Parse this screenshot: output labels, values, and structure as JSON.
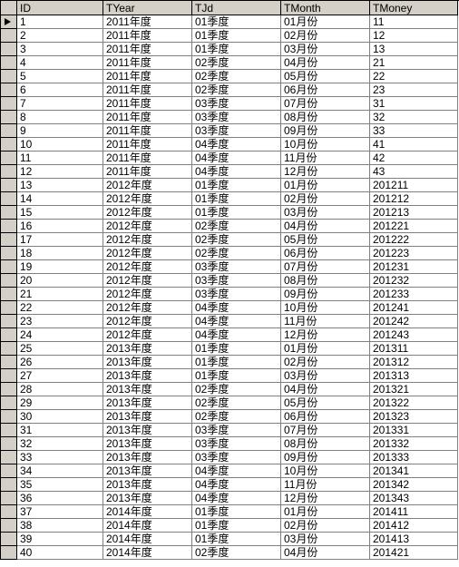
{
  "columns": {
    "id": "ID",
    "tyear": "TYear",
    "tjd": "TJd",
    "tmonth": "TMonth",
    "tmoney": "TMoney"
  },
  "rows": [
    {
      "id": "1",
      "tyear": "2011年度",
      "tjd": "01季度",
      "tmonth": "01月份",
      "tmoney": "11"
    },
    {
      "id": "2",
      "tyear": "2011年度",
      "tjd": "01季度",
      "tmonth": "02月份",
      "tmoney": "12"
    },
    {
      "id": "3",
      "tyear": "2011年度",
      "tjd": "01季度",
      "tmonth": "03月份",
      "tmoney": "13"
    },
    {
      "id": "4",
      "tyear": "2011年度",
      "tjd": "02季度",
      "tmonth": "04月份",
      "tmoney": "21"
    },
    {
      "id": "5",
      "tyear": "2011年度",
      "tjd": "02季度",
      "tmonth": "05月份",
      "tmoney": "22"
    },
    {
      "id": "6",
      "tyear": "2011年度",
      "tjd": "02季度",
      "tmonth": "06月份",
      "tmoney": "23"
    },
    {
      "id": "7",
      "tyear": "2011年度",
      "tjd": "03季度",
      "tmonth": "07月份",
      "tmoney": "31"
    },
    {
      "id": "8",
      "tyear": "2011年度",
      "tjd": "03季度",
      "tmonth": "08月份",
      "tmoney": "32"
    },
    {
      "id": "9",
      "tyear": "2011年度",
      "tjd": "03季度",
      "tmonth": "09月份",
      "tmoney": "33"
    },
    {
      "id": "10",
      "tyear": "2011年度",
      "tjd": "04季度",
      "tmonth": "10月份",
      "tmoney": "41"
    },
    {
      "id": "11",
      "tyear": "2011年度",
      "tjd": "04季度",
      "tmonth": "11月份",
      "tmoney": "42"
    },
    {
      "id": "12",
      "tyear": "2011年度",
      "tjd": "04季度",
      "tmonth": "12月份",
      "tmoney": "43"
    },
    {
      "id": "13",
      "tyear": "2012年度",
      "tjd": "01季度",
      "tmonth": "01月份",
      "tmoney": "201211"
    },
    {
      "id": "14",
      "tyear": "2012年度",
      "tjd": "01季度",
      "tmonth": "02月份",
      "tmoney": "201212"
    },
    {
      "id": "15",
      "tyear": "2012年度",
      "tjd": "01季度",
      "tmonth": "03月份",
      "tmoney": "201213"
    },
    {
      "id": "16",
      "tyear": "2012年度",
      "tjd": "02季度",
      "tmonth": "04月份",
      "tmoney": "201221"
    },
    {
      "id": "17",
      "tyear": "2012年度",
      "tjd": "02季度",
      "tmonth": "05月份",
      "tmoney": "201222"
    },
    {
      "id": "18",
      "tyear": "2012年度",
      "tjd": "02季度",
      "tmonth": "06月份",
      "tmoney": "201223"
    },
    {
      "id": "19",
      "tyear": "2012年度",
      "tjd": "03季度",
      "tmonth": "07月份",
      "tmoney": "201231"
    },
    {
      "id": "20",
      "tyear": "2012年度",
      "tjd": "03季度",
      "tmonth": "08月份",
      "tmoney": "201232"
    },
    {
      "id": "21",
      "tyear": "2012年度",
      "tjd": "03季度",
      "tmonth": "09月份",
      "tmoney": "201233"
    },
    {
      "id": "22",
      "tyear": "2012年度",
      "tjd": "04季度",
      "tmonth": "10月份",
      "tmoney": "201241"
    },
    {
      "id": "23",
      "tyear": "2012年度",
      "tjd": "04季度",
      "tmonth": "11月份",
      "tmoney": "201242"
    },
    {
      "id": "24",
      "tyear": "2012年度",
      "tjd": "04季度",
      "tmonth": "12月份",
      "tmoney": "201243"
    },
    {
      "id": "25",
      "tyear": "2013年度",
      "tjd": "01季度",
      "tmonth": "01月份",
      "tmoney": "201311"
    },
    {
      "id": "26",
      "tyear": "2013年度",
      "tjd": "01季度",
      "tmonth": "02月份",
      "tmoney": "201312"
    },
    {
      "id": "27",
      "tyear": "2013年度",
      "tjd": "01季度",
      "tmonth": "03月份",
      "tmoney": "201313"
    },
    {
      "id": "28",
      "tyear": "2013年度",
      "tjd": "02季度",
      "tmonth": "04月份",
      "tmoney": "201321"
    },
    {
      "id": "29",
      "tyear": "2013年度",
      "tjd": "02季度",
      "tmonth": "05月份",
      "tmoney": "201322"
    },
    {
      "id": "30",
      "tyear": "2013年度",
      "tjd": "02季度",
      "tmonth": "06月份",
      "tmoney": "201323"
    },
    {
      "id": "31",
      "tyear": "2013年度",
      "tjd": "03季度",
      "tmonth": "07月份",
      "tmoney": "201331"
    },
    {
      "id": "32",
      "tyear": "2013年度",
      "tjd": "03季度",
      "tmonth": "08月份",
      "tmoney": "201332"
    },
    {
      "id": "33",
      "tyear": "2013年度",
      "tjd": "03季度",
      "tmonth": "09月份",
      "tmoney": "201333"
    },
    {
      "id": "34",
      "tyear": "2013年度",
      "tjd": "04季度",
      "tmonth": "10月份",
      "tmoney": "201341"
    },
    {
      "id": "35",
      "tyear": "2013年度",
      "tjd": "04季度",
      "tmonth": "11月份",
      "tmoney": "201342"
    },
    {
      "id": "36",
      "tyear": "2013年度",
      "tjd": "04季度",
      "tmonth": "12月份",
      "tmoney": "201343"
    },
    {
      "id": "37",
      "tyear": "2014年度",
      "tjd": "01季度",
      "tmonth": "01月份",
      "tmoney": "201411"
    },
    {
      "id": "38",
      "tyear": "2014年度",
      "tjd": "01季度",
      "tmonth": "02月份",
      "tmoney": "201412"
    },
    {
      "id": "39",
      "tyear": "2014年度",
      "tjd": "01季度",
      "tmonth": "03月份",
      "tmoney": "201413"
    },
    {
      "id": "40",
      "tyear": "2014年度",
      "tjd": "02季度",
      "tmonth": "04月份",
      "tmoney": "201421"
    }
  ],
  "current_row_index": 0
}
